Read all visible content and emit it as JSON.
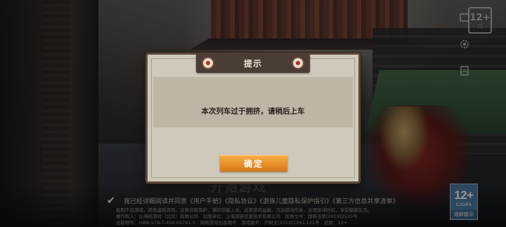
{
  "dialog": {
    "title": "提示",
    "message": "本次列车过于拥挤，请稍后上车",
    "confirm_label": "确定"
  },
  "background": {
    "title_faded": "开始游戏"
  },
  "agreement": {
    "checked": true,
    "text": "我已经详细阅读并同意《用户手册》《隐私协议》《游族儿童隐私保护指引》《第三方信息共享清单》"
  },
  "legal": {
    "line1": "抵制不良游戏，拒绝盗版游戏。注意自我保护，谨防受骗上当。适度游戏益脑，沉迷游戏伤身。合理安排时间，享受健康生活。",
    "line2": "著作权人：山海经游戏（北京）有限公司　出版单位：上海游族信息技术有限公司　批准文号：国新出审[2019]2533号",
    "line3": "出版物号：ISBN 978-7-498-06781-5　网络游戏出版物号　游戏版号：沪网文[2019]1391-131号　适龄：12+"
  },
  "age_rating": {
    "value": "12+",
    "org": "CADPA",
    "tip": "适龄提示"
  },
  "colors": {
    "dialog_bg": "#cfc9bb",
    "dialog_border": "#5a4838",
    "title_bar": "#4a3d33",
    "confirm_button": "#e8902a",
    "age_badge": "#4e7aa0"
  },
  "icons": [
    "age-rating-icon",
    "notice-icon",
    "settings-icon",
    "account-icon"
  ]
}
